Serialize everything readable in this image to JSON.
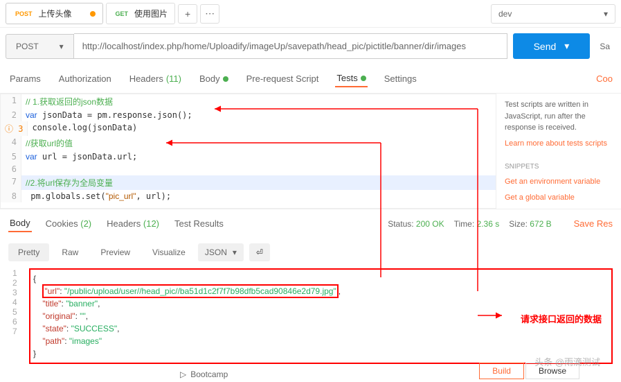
{
  "tabs": [
    {
      "method": "POST",
      "label": "上传头像",
      "hasDot": true
    },
    {
      "method": "GET",
      "label": "使用图片",
      "hasDot": false
    }
  ],
  "environment": "dev",
  "urlBar": {
    "method": "POST",
    "url": "http://localhost/index.php/home/Uploadify/imageUp/savepath/head_pic/pictitle/banner/dir/images"
  },
  "buttons": {
    "send": "Send",
    "save": "Sa",
    "saveRes": "Save Res",
    "cookies": "Coo"
  },
  "requestTabs": {
    "params": "Params",
    "auth": "Authorization",
    "headers": "Headers",
    "headersCount": "(11)",
    "body": "Body",
    "prereq": "Pre-request Script",
    "tests": "Tests",
    "settings": "Settings"
  },
  "testScript": {
    "lines": [
      {
        "n": 1,
        "type": "comment",
        "text": "// 1.获取返回的json数据"
      },
      {
        "n": 2,
        "type": "code",
        "text": "var jsonData = pm.response.json();"
      },
      {
        "n": 3,
        "type": "code",
        "text": "console.log(jsonData)"
      },
      {
        "n": 4,
        "type": "comment",
        "text": "//获取url的值"
      },
      {
        "n": 5,
        "type": "code",
        "text": "var url = jsonData.url;"
      },
      {
        "n": 6,
        "type": "blank",
        "text": ""
      },
      {
        "n": 7,
        "type": "comment",
        "text": "//2.将url保存为全局变量"
      },
      {
        "n": 8,
        "type": "code",
        "text": " pm.globals.set(\"pic_url\", url);"
      }
    ]
  },
  "sidebar": {
    "desc": "Test scripts are written in JavaScript, run after the response is received.",
    "learn": "Learn more about tests scripts",
    "snippetsTitle": "SNIPPETS",
    "snippet1": "Get an environment variable",
    "snippet2": "Get a global variable"
  },
  "responseTabs": {
    "body": "Body",
    "cookies": "Cookies",
    "cookiesCount": "(2)",
    "headers": "Headers",
    "headersCount": "(12)",
    "testResults": "Test Results"
  },
  "responseMeta": {
    "statusLabel": "Status:",
    "status": "200 OK",
    "timeLabel": "Time:",
    "time": "2.36 s",
    "sizeLabel": "Size:",
    "size": "672 B"
  },
  "viewTabs": {
    "pretty": "Pretty",
    "raw": "Raw",
    "preview": "Preview",
    "visualize": "Visualize",
    "format": "JSON"
  },
  "responseBody": {
    "lines": [
      "{",
      "    \"url\": \"/public/upload/user//head_pic//ba51d1c2f7f7b98dfb5cad90846e2d79.jpg\",",
      "    \"title\": \"banner\",",
      "    \"original\": \"\",",
      "    \"state\": \"SUCCESS\",",
      "    \"path\": \"images\"",
      "}"
    ]
  },
  "annotation": "请求接口返回的数据",
  "bootcamp": "Bootcamp",
  "buildBrowse": {
    "build": "Build",
    "browse": "Browse"
  },
  "watermark": "头条 @雨滴测试"
}
